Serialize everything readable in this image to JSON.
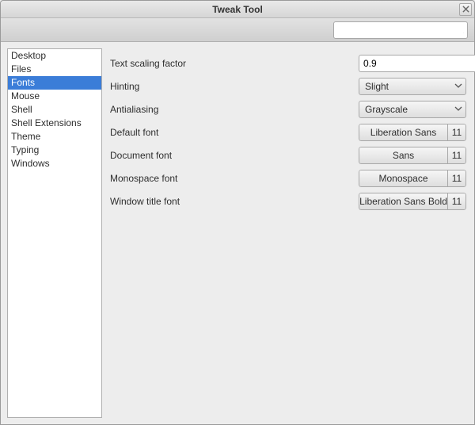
{
  "window": {
    "title": "Tweak Tool"
  },
  "search": {
    "placeholder": ""
  },
  "sidebar": {
    "items": [
      {
        "label": "Desktop",
        "selected": false
      },
      {
        "label": "Files",
        "selected": false
      },
      {
        "label": "Fonts",
        "selected": true
      },
      {
        "label": "Mouse",
        "selected": false
      },
      {
        "label": "Shell",
        "selected": false
      },
      {
        "label": "Shell Extensions",
        "selected": false
      },
      {
        "label": "Theme",
        "selected": false
      },
      {
        "label": "Typing",
        "selected": false
      },
      {
        "label": "Windows",
        "selected": false
      }
    ]
  },
  "settings": {
    "text_scaling": {
      "label": "Text scaling factor",
      "value": "0.9"
    },
    "hinting": {
      "label": "Hinting",
      "value": "Slight"
    },
    "antialiasing": {
      "label": "Antialiasing",
      "value": "Grayscale"
    },
    "default_font": {
      "label": "Default font",
      "name": "Liberation Sans",
      "size": "11"
    },
    "document_font": {
      "label": "Document font",
      "name": "Sans",
      "size": "11"
    },
    "monospace_font": {
      "label": "Monospace font",
      "name": "Monospace",
      "size": "11"
    },
    "window_title_font": {
      "label": "Window title font",
      "name": "Liberation Sans Bold",
      "size": "11"
    }
  }
}
